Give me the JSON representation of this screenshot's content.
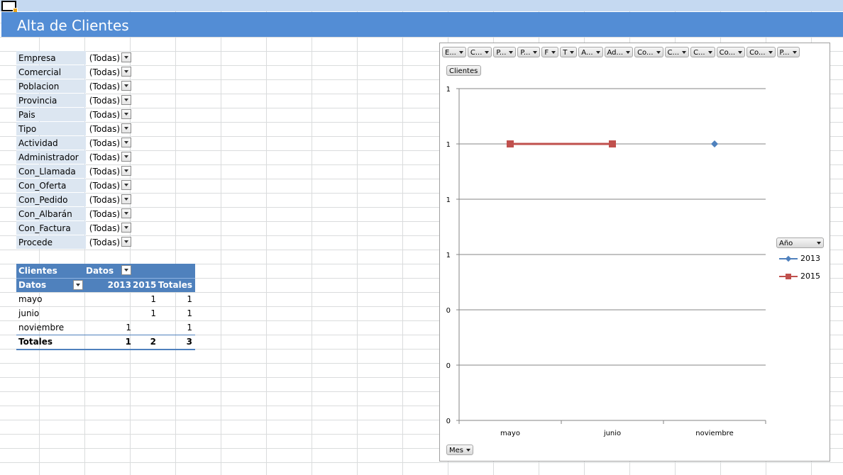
{
  "sheet": {
    "title": "Alta de Clientes"
  },
  "filters": [
    {
      "label": "Empresa",
      "value": "(Todas)"
    },
    {
      "label": "Comercial",
      "value": "(Todas)"
    },
    {
      "label": "Poblacion",
      "value": "(Todas)"
    },
    {
      "label": "Provincia",
      "value": "(Todas)"
    },
    {
      "label": "Pais",
      "value": "(Todas)"
    },
    {
      "label": "Tipo",
      "value": "(Todas)"
    },
    {
      "label": "Actividad",
      "value": "(Todas)"
    },
    {
      "label": "Administrador",
      "value": "(Todas)"
    },
    {
      "label": "Con_Llamada",
      "value": "(Todas)"
    },
    {
      "label": "Con_Oferta",
      "value": "(Todas)"
    },
    {
      "label": "Con_Pedido",
      "value": "(Todas)"
    },
    {
      "label": "Con_Albarán",
      "value": "(Todas)"
    },
    {
      "label": "Con_Factura",
      "value": "(Todas)"
    },
    {
      "label": "Procede",
      "value": "(Todas)"
    }
  ],
  "pivot": {
    "values_label": "Clientes",
    "columns_label": "Datos",
    "rows_label": "Datos",
    "col_headers": [
      "2013",
      "2015",
      "Totales"
    ],
    "rows": [
      {
        "label": "mayo",
        "c2013": "",
        "c2015": "1",
        "total": "1"
      },
      {
        "label": "junio",
        "c2013": "",
        "c2015": "1",
        "total": "1"
      },
      {
        "label": "noviembre",
        "c2013": "1",
        "c2015": "",
        "total": "1"
      }
    ],
    "totals": {
      "label": "Totales",
      "c2013": "1",
      "c2015": "2",
      "total": "3"
    }
  },
  "chart": {
    "field_buttons": [
      "E...",
      "C...",
      "P...",
      "P...",
      "F",
      "T",
      "A...",
      "Ad...",
      "Co...",
      "C...",
      "C...",
      "Co...",
      "Co...",
      "P..."
    ],
    "values_button": "Clientes",
    "axis_button": "Mes",
    "legend_button": "Año"
  },
  "chart_data": {
    "type": "line",
    "categories": [
      "mayo",
      "junio",
      "noviembre"
    ],
    "y_tick_labels": [
      "0",
      "0",
      "0",
      "1",
      "1",
      "1",
      "1"
    ],
    "ylim": [
      0,
      1.2
    ],
    "grid": true,
    "legend_position": "right",
    "series": [
      {
        "name": "2013",
        "color": "#4f81bd",
        "marker": "diamond",
        "values": [
          null,
          null,
          1
        ]
      },
      {
        "name": "2015",
        "color": "#c0504d",
        "marker": "square",
        "values": [
          1,
          1,
          null
        ]
      }
    ]
  }
}
